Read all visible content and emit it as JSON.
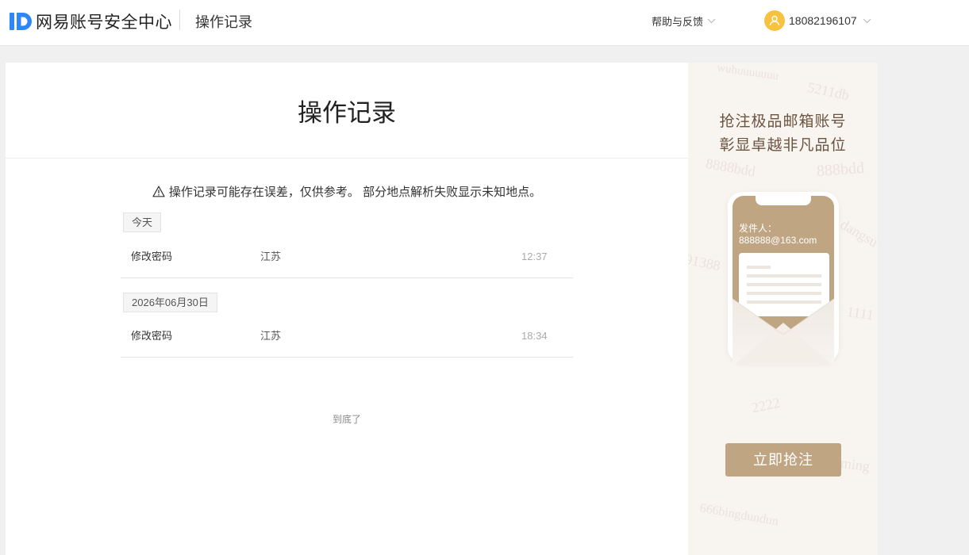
{
  "header": {
    "brand": "网易账号安全中心",
    "page_name": "操作记录",
    "help_label": "帮助与反馈",
    "username": "18082196107"
  },
  "main": {
    "title": "操作记录",
    "notice": "操作记录可能存在误差，仅供参考。 部分地点解析失败显示未知地点。",
    "groups": [
      {
        "date": "今天",
        "records": [
          {
            "action": "修改密码",
            "location": "江苏",
            "time": "12:37"
          }
        ]
      },
      {
        "date": "2026年06月30日",
        "records": [
          {
            "action": "修改密码",
            "location": "江苏",
            "time": "18:34"
          }
        ]
      }
    ],
    "end_note": "到底了"
  },
  "ad": {
    "headline_1": "抢注极品邮箱账号",
    "headline_2": "彰显卓越非凡品位",
    "sender_label": "发件人：",
    "sender_email": "888888@163.com",
    "cta_label": "立即抢注",
    "watermarks": [
      "5211db",
      "wuhuuuuuuu",
      "8888bdd",
      "888bdd",
      "dangsu",
      "91388",
      "1111",
      "2222",
      "ming",
      "666bingdundun"
    ]
  },
  "colors": {
    "accent_gold": "#c0a583",
    "avatar_yellow": "#f7c240",
    "logo_blue": "#2f86f6"
  },
  "icons": [
    "logo-icon",
    "chevron-down-icon",
    "user-icon",
    "warning-icon"
  ]
}
